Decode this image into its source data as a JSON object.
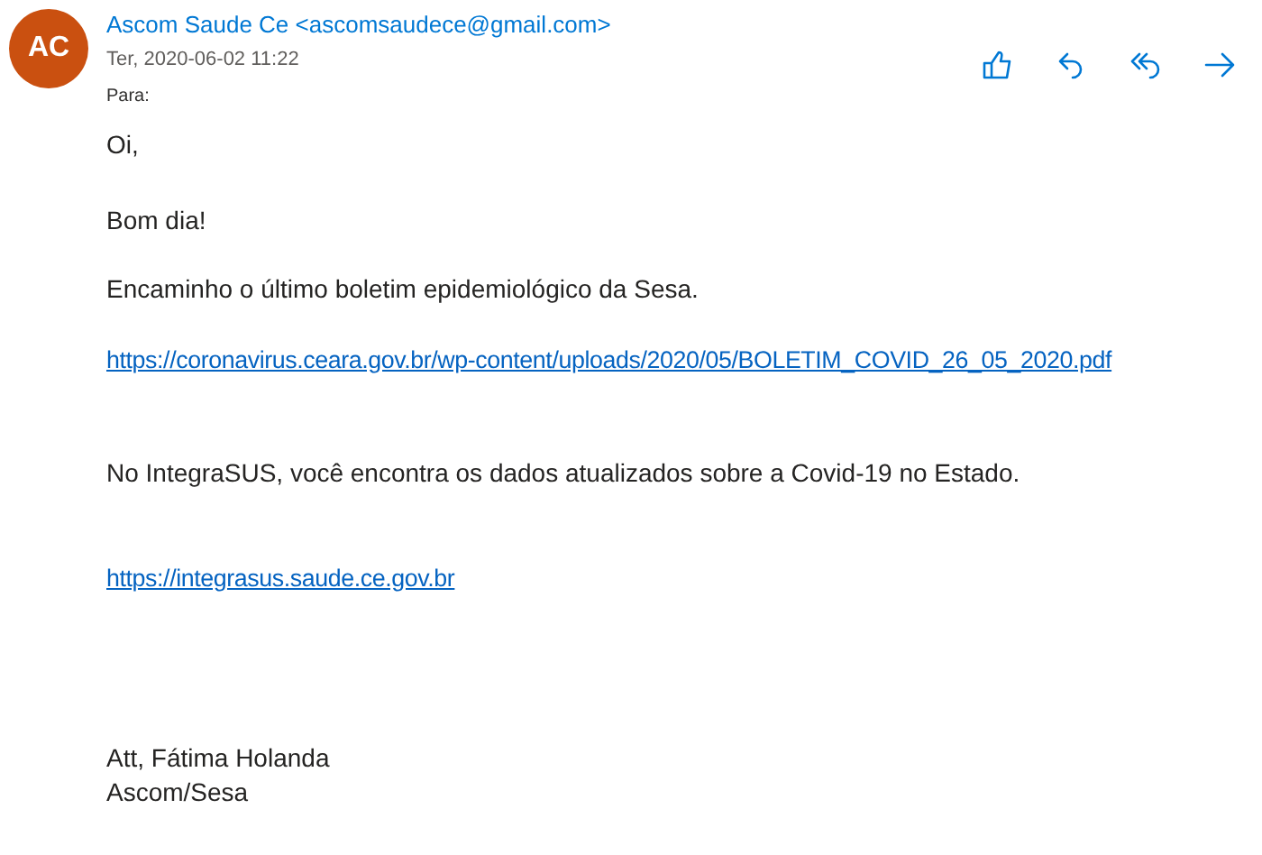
{
  "sender": {
    "initials": "AC",
    "name": "Ascom Saude Ce <ascomsaudece@gmail.com>",
    "date": "Ter, 2020-06-02 11:22",
    "to_label": "Para:"
  },
  "actions": [
    {
      "kind": "like"
    },
    {
      "kind": "reply"
    },
    {
      "kind": "reply-all"
    },
    {
      "kind": "forward"
    }
  ],
  "body": [
    {
      "kind": "text",
      "text": "Oi,"
    },
    {
      "kind": "text",
      "text": "Bom dia!"
    },
    {
      "kind": "text",
      "text": "Encaminho o último boletim epidemiológico da Sesa."
    },
    {
      "kind": "link",
      "text": "https://coronavirus.ceara.gov.br/wp-content/uploads/2020/05/BOLETIM_COVID_26_05_2020.pdf"
    },
    {
      "kind": "text",
      "text": "No IntegraSUS, você encontra os dados atualizados sobre a Covid-19 no Estado."
    },
    {
      "kind": "link",
      "text": "https://integrasus.saude.ce.gov.br"
    },
    {
      "kind": "text",
      "text": "Att, Fátima Holanda"
    },
    {
      "kind": "text",
      "text": "Ascom/Sesa"
    }
  ]
}
